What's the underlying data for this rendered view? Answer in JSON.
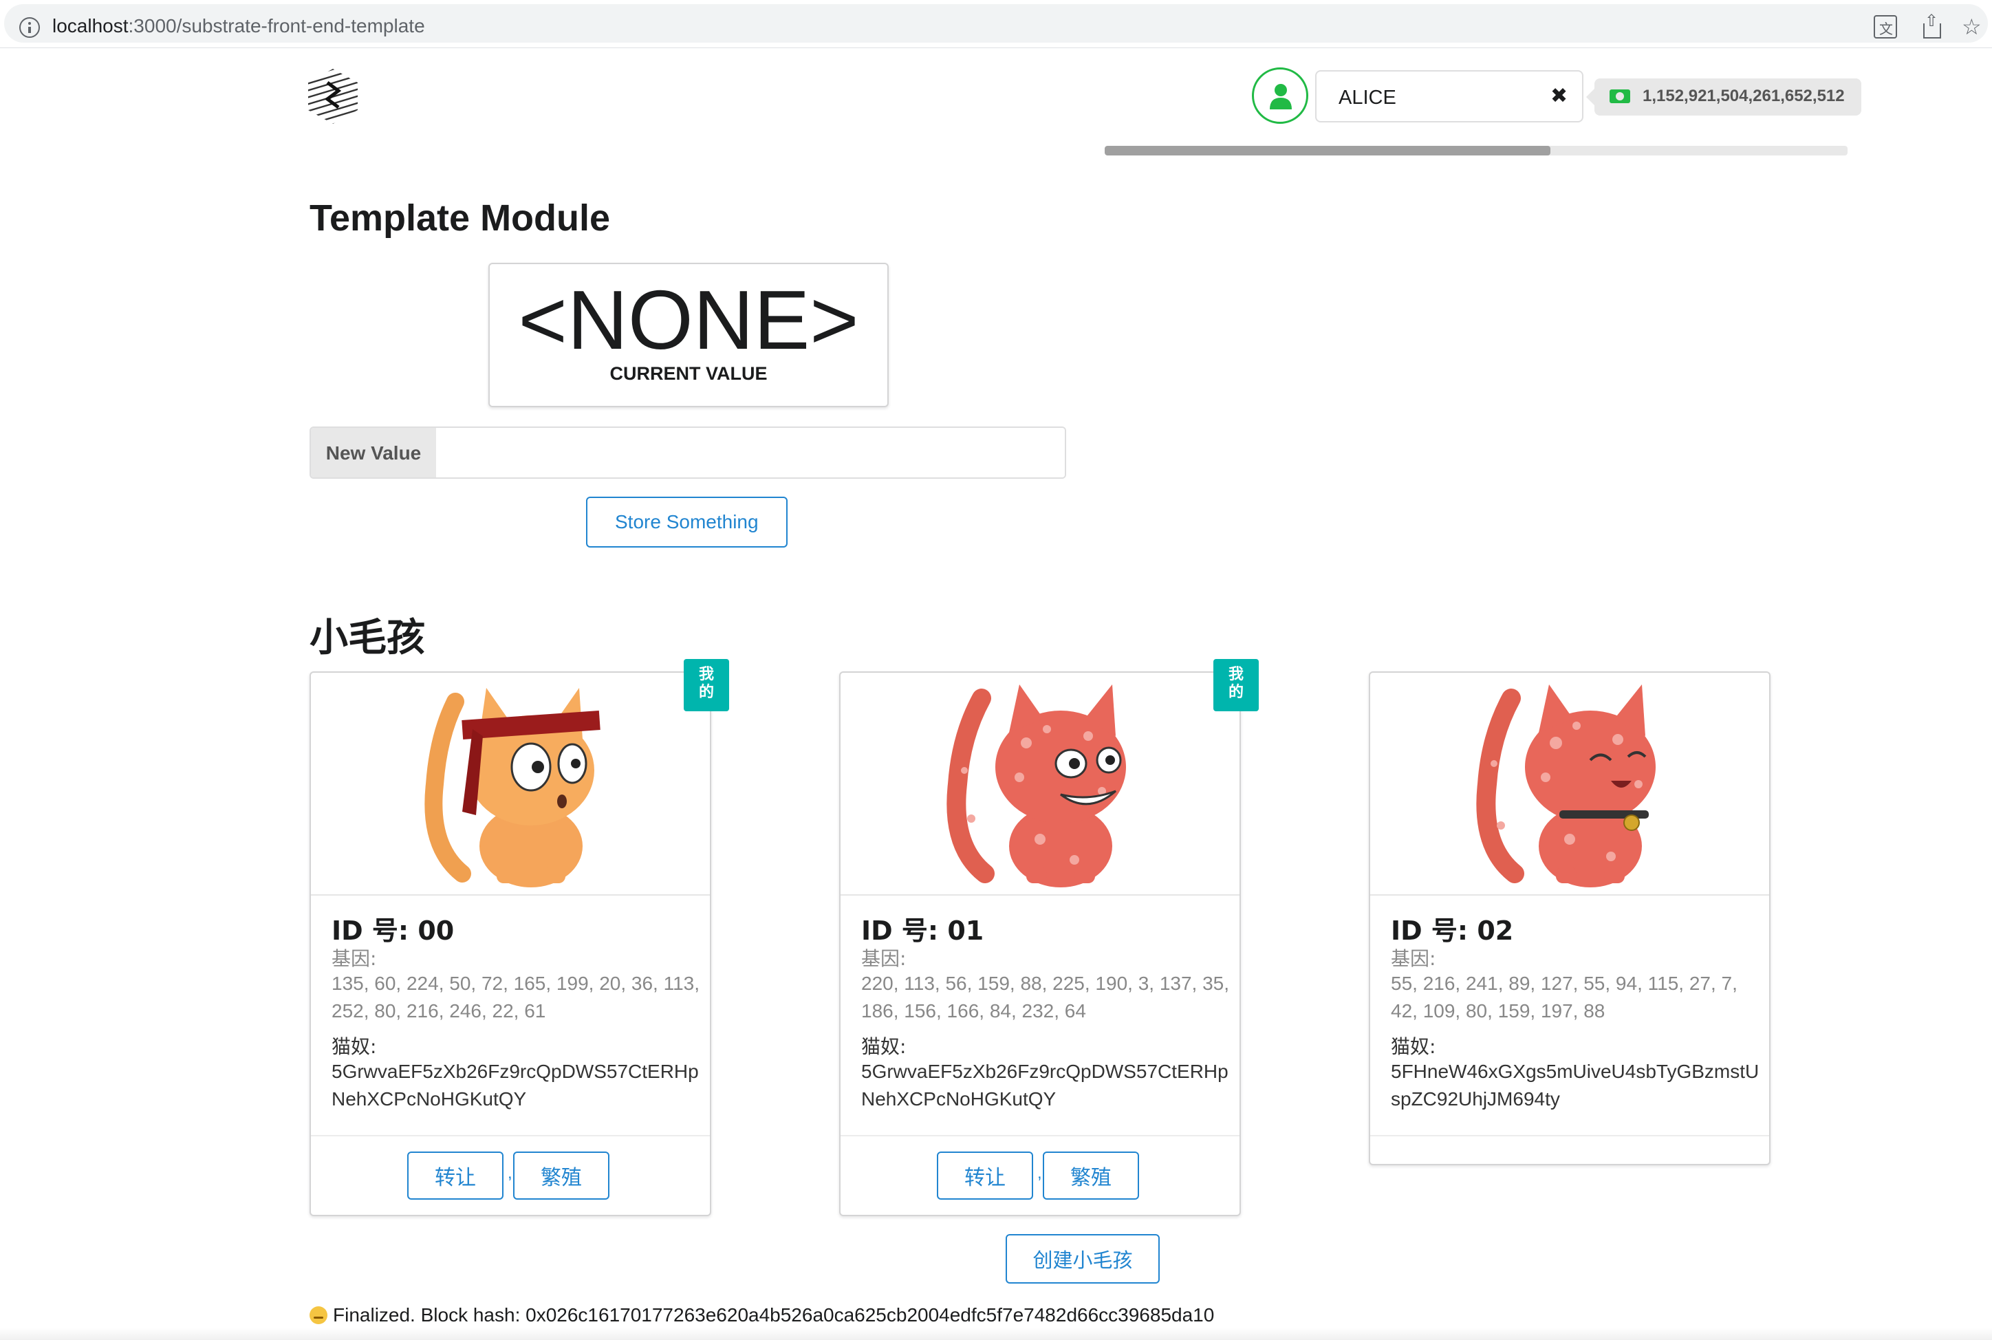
{
  "browser": {
    "url_host": "localhost",
    "url_path": ":3000/substrate-front-end-template"
  },
  "header": {
    "account_name": "ALICE",
    "balance": "1,152,921,504,261,652,512",
    "progress_fraction": 0.6,
    "colors": {
      "account_ok": "#21ba45",
      "balance_bg": "#e8e8e8"
    }
  },
  "template_module": {
    "title": "Template Module",
    "current_value": "<NONE>",
    "current_value_label": "CURRENT VALUE",
    "input_label": "New Value",
    "input_value": "",
    "store_button": "Store Something"
  },
  "kitties": {
    "title": "小毛孩",
    "dna_label": "基因:",
    "owner_label": "猫奴:",
    "mine_ribbon": "我的",
    "transfer_button": "转让",
    "breed_button": "繁殖",
    "create_button": "创建小毛孩",
    "items": [
      {
        "id_label": "ID 号: 00",
        "dna": "135, 60, 224, 50, 72, 165, 199, 20, 36, 113, 252, 80, 216, 246, 22, 61",
        "owner": "5GrwvaEF5zXb26Fz9rcQpDWS57CtERHpNehXCPcNoHGKutQY",
        "is_mine": true,
        "image": "orange-cat-headband"
      },
      {
        "id_label": "ID 号: 01",
        "dna": "220, 113, 56, 159, 88, 225, 190, 3, 137, 35, 186, 156, 166, 84, 232, 64",
        "owner": "5GrwvaEF5zXb26Fz9rcQpDWS57CtERHpNehXCPcNoHGKutQY",
        "is_mine": true,
        "image": "red-spotted-cat-grin"
      },
      {
        "id_label": "ID 号: 02",
        "dna": "55, 216, 241, 89, 127, 55, 94, 115, 27, 7, 42, 109, 80, 159, 197, 88",
        "owner": "5FHneW46xGXgs5mUiveU4sbTyGBzmstUspZC92UhjJM694ty",
        "is_mine": false,
        "image": "red-spotted-cat-collar"
      }
    ]
  },
  "status": {
    "text": "Finalized. Block hash: 0x026c16170177263e620a4b526a0ca625cb2004edfc5f7e7482d66cc39685da10",
    "emoji": "smirk-emoji"
  }
}
